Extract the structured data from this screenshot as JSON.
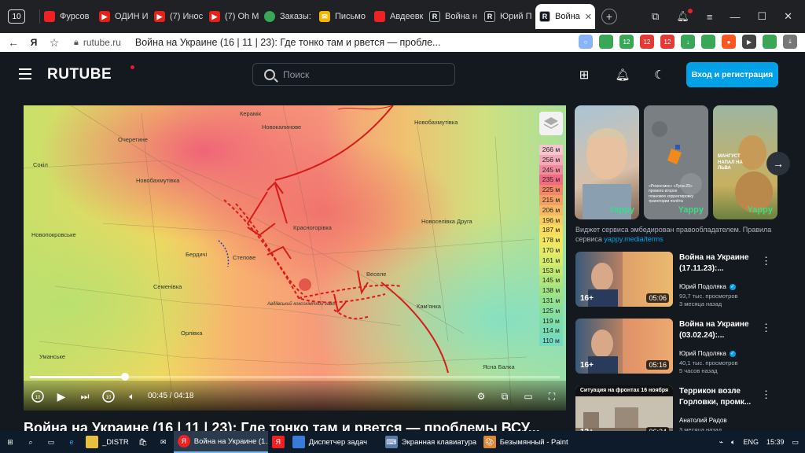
{
  "browser": {
    "tab_count": "10",
    "tabs": [
      {
        "label": "Фурсов",
        "favicon": "red-square-icon"
      },
      {
        "label": "ОДИН И",
        "favicon": "youtube-icon"
      },
      {
        "label": "(7) Инос",
        "favicon": "youtube-icon"
      },
      {
        "label": "(7) Oh M",
        "favicon": "youtube-icon"
      },
      {
        "label": "Заказы:",
        "favicon": "dots-icon"
      },
      {
        "label": "Письмо",
        "favicon": "mail-icon"
      },
      {
        "label": "Авдеевк",
        "favicon": "red-square-icon"
      },
      {
        "label": "Война н",
        "favicon": "rutube-icon"
      },
      {
        "label": "Юрий П",
        "favicon": "rutube-icon"
      },
      {
        "label": "Война",
        "favicon": "rutube-icon",
        "active": true
      }
    ],
    "new_tab": "+",
    "address": {
      "domain": "rutube.ru",
      "title": "Война на Украине (16 | 11 | 23): Где тонко там и рвется — пробле..."
    },
    "extension_badges": [
      "12",
      "12",
      "12"
    ]
  },
  "site": {
    "logo": "RUTUBE",
    "search_placeholder": "Поиск",
    "login_button": "Вход и регистрация",
    "brand_color": "#00a1e7",
    "accent_color": "#ed143b"
  },
  "player": {
    "map_labels": {
      "keramik": "Керамік",
      "novokalynove": "Новокалинове",
      "novobakhmutivka_top": "Новобахмутівка",
      "ocheretyne": "Очеретине",
      "sokil": "Сокіл",
      "novobakhmutivka": "Новобахмутівка",
      "novopokrovske": "Новопокровське",
      "berdychi": "Бердичі",
      "stepove": "Степове",
      "krasnohorivka": "Красногорівка",
      "novoselivka": "Новоселівка Друга",
      "semenivka": "Семенівка",
      "vesele": "Веселе",
      "orlivka": "Орлівка",
      "plant": "Авдіївський коксохімічний завод",
      "kamianka": "Кам'янка",
      "umanske": "Уманське",
      "yasnobrodivka": "Ясна Балка"
    },
    "legend": [
      "266 м",
      "256 м",
      "245 м",
      "235 м",
      "225 м",
      "215 м",
      "206 м",
      "196 м",
      "187 м",
      "178 м",
      "170 м",
      "161 м",
      "153 м",
      "145 м",
      "138 м",
      "131 м",
      "125 м",
      "119 м",
      "114 м",
      "110 м"
    ],
    "progress": 0.179,
    "time_current": "00:45",
    "time_total": "04:18",
    "time_display": "00:45 / 04:18",
    "rewind_label": "10",
    "forward_label": "10"
  },
  "video_title_partial": "Война на Украине (16 | 11 | 23): Где тонко там и рвется — проблемы ВСУ...",
  "shorts": [
    {
      "brand": "Yappy",
      "caption": ""
    },
    {
      "brand": "Yappy",
      "caption": "«Роскосмос» «Луна-25» провело второе плановое корректировку траектории полёта"
    },
    {
      "brand": "Yappy",
      "caption": "МАНГУСТ НАПАЛ НА ЛЬВА"
    }
  ],
  "widget_note": {
    "text": "Виджет сервиса эмбедирован правообладателем. Правила сервиса",
    "link": "yappy.media/terms"
  },
  "recommendations": [
    {
      "title": "Война на Украине (17.11.23):...",
      "author": "Юрий Подоляка",
      "views": "93,7 тыс. просмотров",
      "ago": "3 месяца назад",
      "age": "16+",
      "duration": "05:06"
    },
    {
      "title": "Война на Украине (03.02.24):...",
      "author": "Юрий Подоляка",
      "views": "40,1 тыс. просмотров",
      "ago": "5 часов назад",
      "age": "16+",
      "duration": "05:16"
    },
    {
      "title": "Террикон возле Горловки, промк...",
      "author": "Анатолий Радов",
      "views": "",
      "ago": "3 месяца назад",
      "age": "12+",
      "duration": "06:24",
      "thumb_text": "Ситуация на фронтах 16 ноября"
    }
  ],
  "taskbar": {
    "items": [
      {
        "label": "_DISTR"
      },
      {
        "label": "Война на Украине (1..."
      },
      {
        "label": "Диспетчер задач"
      },
      {
        "label": "Экранная клавиатура"
      },
      {
        "label": "Безымянный - Paint"
      }
    ],
    "lang": "ENG",
    "clock": "15:39"
  }
}
